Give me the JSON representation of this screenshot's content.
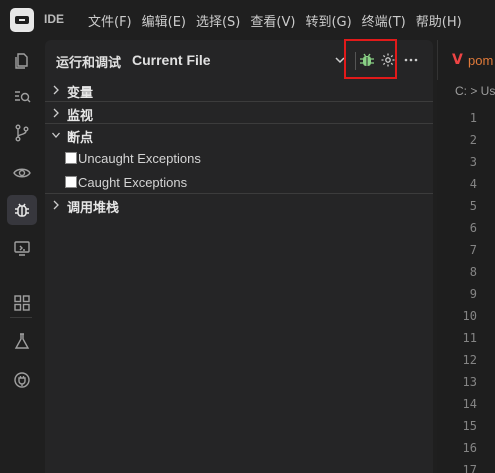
{
  "titlebar": {
    "app_label": "IDE",
    "menu": [
      "文件(F)",
      "编辑(E)",
      "选择(S)",
      "查看(V)",
      "转到(G)",
      "终端(T)",
      "帮助(H)"
    ]
  },
  "activity_bar": {
    "items": [
      "explorer-icon",
      "search-icon",
      "source-control-icon",
      "watch-icon",
      "debug-icon",
      "remote-icon",
      "extensions-icon",
      "testing-icon",
      "plugin-icon"
    ],
    "active": "debug-icon"
  },
  "run_panel": {
    "title": "运行和调试",
    "configuration": "Current File",
    "sections": {
      "variables": "变量",
      "watch": "监视",
      "breakpoints": "断点",
      "call_stack": "调用堆栈"
    },
    "breakpoints": [
      {
        "label": "Uncaught Exceptions",
        "checked": false
      },
      {
        "label": "Caught Exceptions",
        "checked": false
      }
    ]
  },
  "editor": {
    "tab_icon": "V",
    "tab_name": "pom",
    "breadcrumb": "C: > Us",
    "line_numbers": [
      "1",
      "2",
      "3",
      "4",
      "5",
      "6",
      "7",
      "8",
      "9",
      "10",
      "11",
      "12",
      "13",
      "14",
      "15",
      "16",
      "17"
    ]
  },
  "colors": {
    "accent_green": "#89d185",
    "highlight_red": "#e11a1a",
    "tab_text": "#e07a3a"
  }
}
